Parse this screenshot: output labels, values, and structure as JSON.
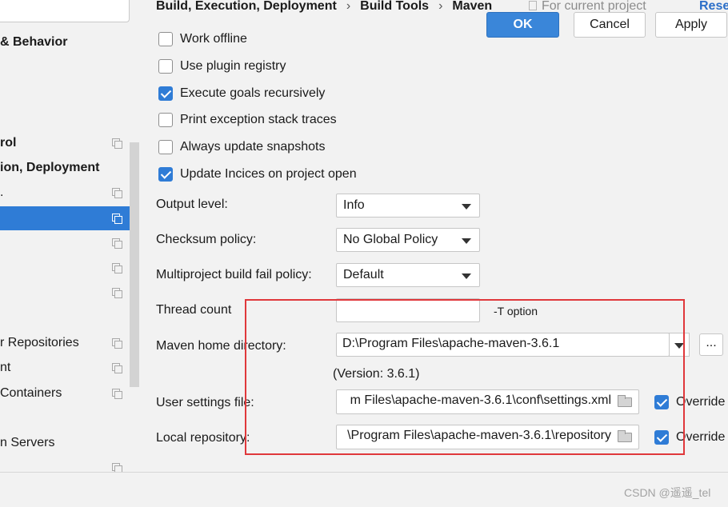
{
  "sidebar": {
    "items": [
      {
        "label": "& Behavior",
        "bold": true,
        "icon": false
      },
      {
        "label": "rol",
        "bold": true,
        "icon": true
      },
      {
        "label": "ion, Deployment",
        "bold": true,
        "icon": false
      },
      {
        "label": ".",
        "bold": false,
        "icon": true
      },
      {
        "label": "",
        "bold": false,
        "icon": true,
        "selected": true
      },
      {
        "label": "",
        "bold": false,
        "icon": true
      },
      {
        "label": "",
        "bold": false,
        "icon": true
      },
      {
        "label": "",
        "bold": false,
        "icon": true
      },
      {
        "label": "r Repositories",
        "bold": false,
        "icon": true
      },
      {
        "label": "nt",
        "bold": false,
        "icon": true
      },
      {
        "label": "Containers",
        "bold": false,
        "icon": true
      },
      {
        "label": "n Servers",
        "bold": false,
        "icon": false
      }
    ]
  },
  "header": {
    "breadcrumb": [
      "Build, Execution, Deployment",
      "Build Tools",
      "Maven"
    ],
    "separator": "›",
    "scope": "For current project",
    "reset": "Reset"
  },
  "options": {
    "work_offline": {
      "label": "Work offline",
      "checked": false
    },
    "use_plugin_registry": {
      "label": "Use plugin registry",
      "checked": false
    },
    "execute_goals": {
      "label": "Execute goals recursively",
      "checked": true
    },
    "print_exception": {
      "label": "Print exception stack traces",
      "checked": false
    },
    "always_update": {
      "label": "Always update snapshots",
      "checked": false
    },
    "update_indices": {
      "label": "Update Incices on project open",
      "checked": true
    }
  },
  "fields": {
    "output_level": {
      "label": "Output level:",
      "value": "Info"
    },
    "checksum_policy": {
      "label": "Checksum policy:",
      "value": "No Global Policy"
    },
    "multiproject": {
      "label": "Multiproject build fail policy:",
      "value": "Default"
    },
    "thread_count": {
      "label": "Thread count",
      "value": "",
      "hint": "-T option"
    },
    "maven_home": {
      "label": "Maven home directory:",
      "value": "D:\\Program Files\\apache-maven-3.6.1",
      "browse": "...",
      "version": "(Version: 3.6.1)"
    },
    "user_settings": {
      "label": "User settings file:",
      "value": "m Files\\apache-maven-3.6.1\\conf\\settings.xml",
      "override": "Override",
      "override_checked": true
    },
    "local_repo": {
      "label": "Local repository:",
      "value": "\\Program Files\\apache-maven-3.6.1\\repository",
      "override": "Override",
      "override_checked": true
    }
  },
  "buttons": {
    "ok": "OK",
    "cancel": "Cancel",
    "apply": "Apply"
  },
  "watermark": "CSDN @遥遥_tel",
  "colors": {
    "accent": "#2f7cd6",
    "highlight_box": "#e0383b",
    "link": "#2c6fc8"
  }
}
